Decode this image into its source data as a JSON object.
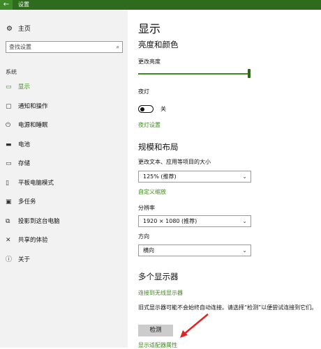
{
  "window": {
    "title": "设置"
  },
  "sidebar": {
    "home_label": "主页",
    "search_placeholder": "查找设置",
    "section_label": "系统",
    "items": [
      {
        "label": "显示",
        "icon": "monitor-icon"
      },
      {
        "label": "通知和操作",
        "icon": "chat-icon"
      },
      {
        "label": "电源和睡眠",
        "icon": "power-icon"
      },
      {
        "label": "电池",
        "icon": "battery-icon"
      },
      {
        "label": "存储",
        "icon": "storage-icon"
      },
      {
        "label": "平板电脑模式",
        "icon": "tablet-icon"
      },
      {
        "label": "多任务",
        "icon": "multitask-icon"
      },
      {
        "label": "投影到这台电脑",
        "icon": "project-icon"
      },
      {
        "label": "共享的体验",
        "icon": "share-icon"
      },
      {
        "label": "关于",
        "icon": "info-icon"
      }
    ]
  },
  "main": {
    "title": "显示",
    "brightness": {
      "heading": "亮度和颜色",
      "label": "更改亮度",
      "level": 1.0
    },
    "night_light": {
      "label": "夜灯",
      "state": "关",
      "settings_link": "夜灯设置"
    },
    "scale_layout": {
      "heading": "规模和布局",
      "scale_label": "更改文本、应用等项目的大小",
      "scale_value": "125% (推荐)",
      "custom_scale_link": "自定义缩放",
      "resolution_label": "分辨率",
      "resolution_value": "1920 × 1080 (推荐)",
      "orientation_label": "方向",
      "orientation_value": "横向"
    },
    "multiple_displays": {
      "heading": "多个显示器",
      "wireless_link": "连接到无线显示器",
      "description": "旧式显示器可能不会始终自动连接。请选择“检测”以便尝试连接到它们。",
      "detect_button": "检测",
      "adapter_link": "显示适配器属性"
    }
  },
  "colors": {
    "accent": "#3d8a1e",
    "titlebar": "#2f6b1d",
    "annotation_arrow": "#e02424"
  }
}
